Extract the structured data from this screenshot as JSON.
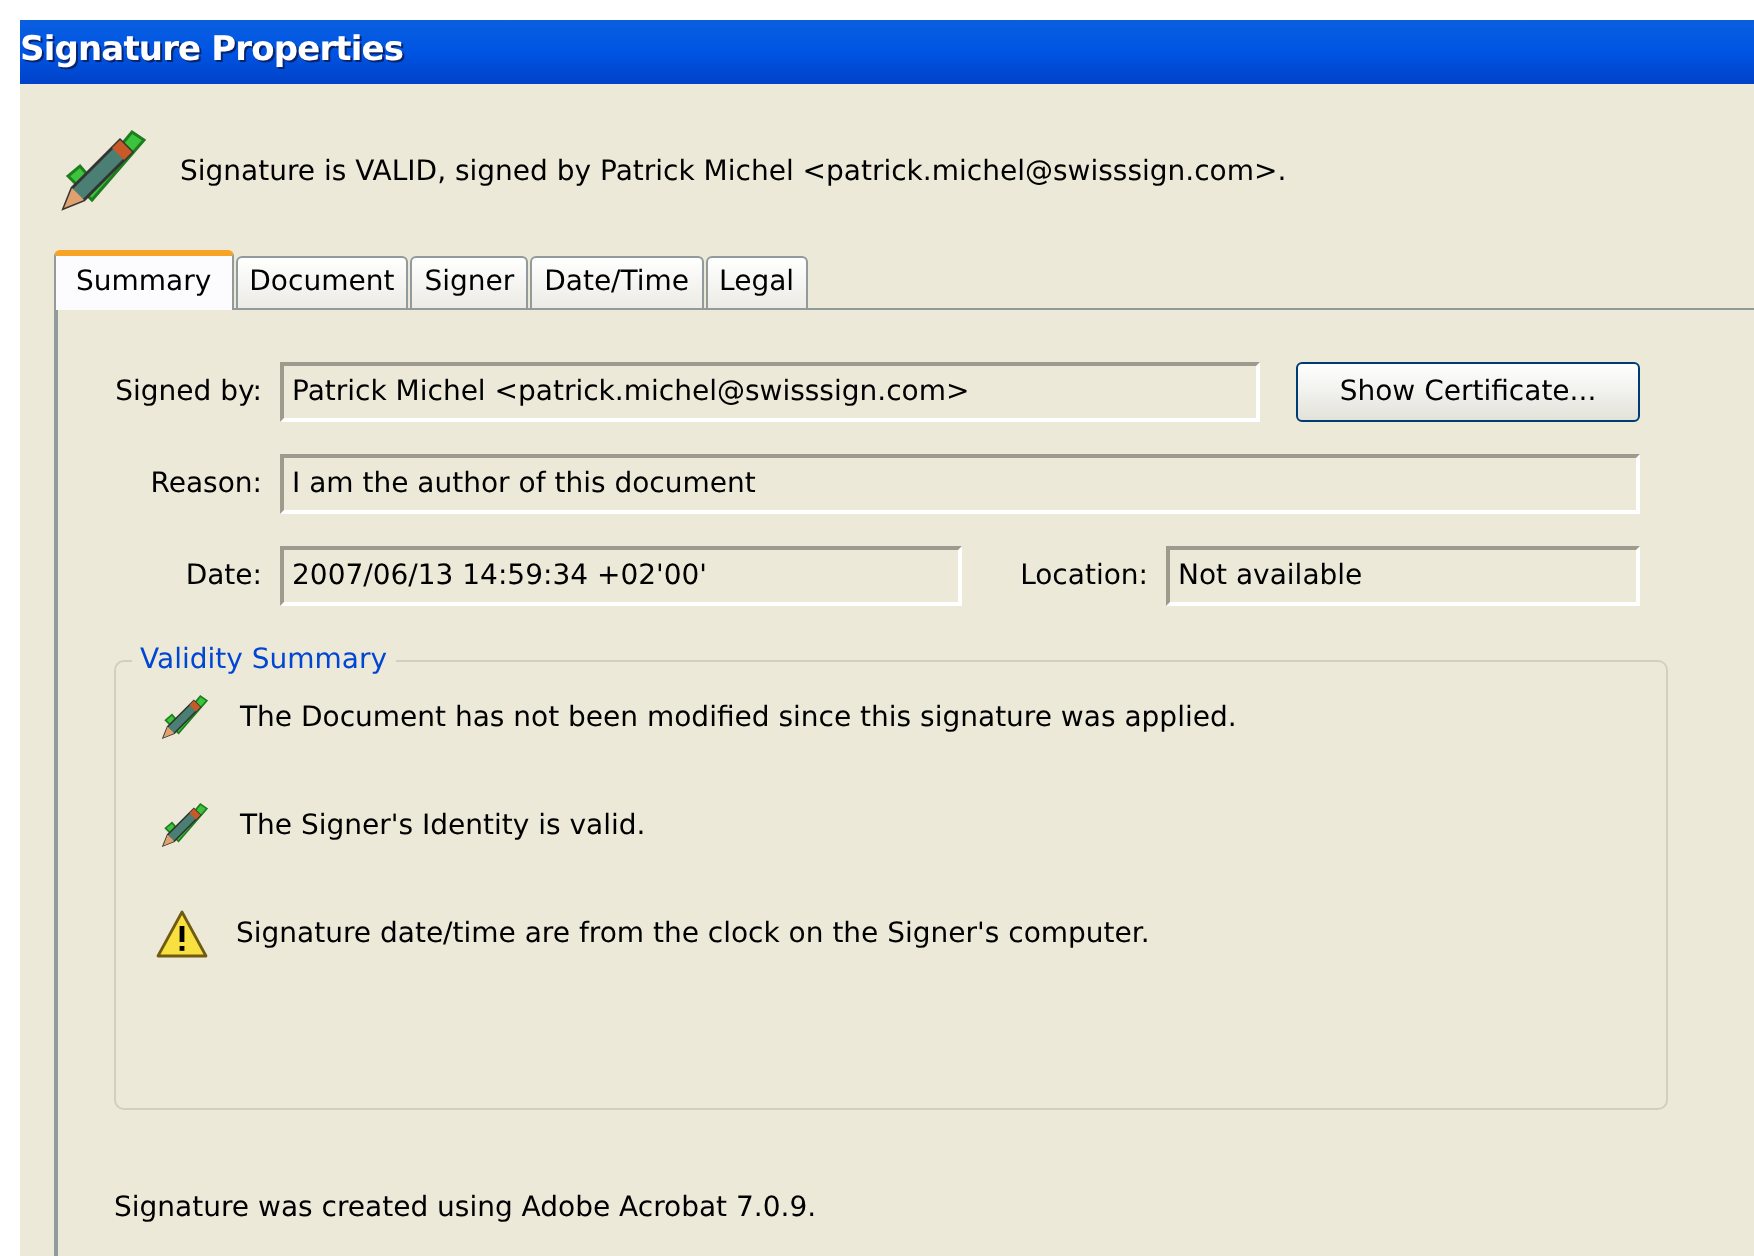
{
  "window": {
    "title": "Signature Properties"
  },
  "status_message": "Signature is VALID, signed by Patrick Michel <patrick.michel@swisssign.com>.",
  "tabs": [
    {
      "label": "Summary",
      "selected": true
    },
    {
      "label": "Document",
      "selected": false
    },
    {
      "label": "Signer",
      "selected": false
    },
    {
      "label": "Date/Time",
      "selected": false
    },
    {
      "label": "Legal",
      "selected": false
    }
  ],
  "fields": {
    "signed_by": {
      "label": "Signed by:",
      "value": "Patrick Michel <patrick.michel@swisssign.com>"
    },
    "show_certificate_button": "Show Certificate...",
    "reason": {
      "label": "Reason:",
      "value": "I am the author of this document"
    },
    "date": {
      "label": "Date:",
      "value": "2007/06/13 14:59:34 +02'00'"
    },
    "location": {
      "label": "Location:",
      "value": "Not available"
    }
  },
  "validity_summary": {
    "title": "Validity Summary",
    "items": [
      {
        "kind": "valid",
        "text": "The Document has not been modified since this signature was applied."
      },
      {
        "kind": "valid",
        "text": "The Signer's Identity is valid."
      },
      {
        "kind": "warning",
        "text": "Signature date/time are from the clock on the Signer's computer."
      }
    ]
  },
  "footer": "Signature was created using Adobe Acrobat 7.0.9."
}
